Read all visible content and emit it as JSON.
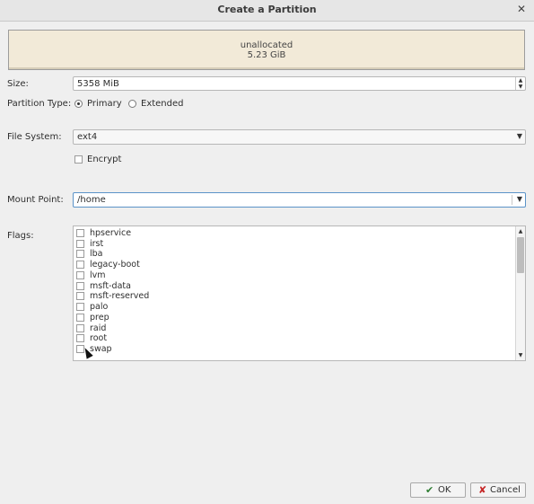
{
  "window": {
    "title": "Create a Partition"
  },
  "partition": {
    "name": "unallocated",
    "size_text": "5.23 GiB"
  },
  "size": {
    "label": "Size:",
    "value": "5358 MiB"
  },
  "partition_type": {
    "label": "Partition Type:",
    "primary": "Primary",
    "extended": "Extended",
    "selected": "Primary"
  },
  "file_system": {
    "label": "File System:",
    "value": "ext4"
  },
  "encrypt": {
    "label": "Encrypt",
    "checked": false
  },
  "mount_point": {
    "label": "Mount Point:",
    "value": "/home"
  },
  "flags": {
    "label": "Flags:",
    "items": [
      "hpservice",
      "irst",
      "lba",
      "legacy-boot",
      "lvm",
      "msft-data",
      "msft-reserved",
      "palo",
      "prep",
      "raid",
      "root",
      "swap"
    ]
  },
  "buttons": {
    "ok": "OK",
    "cancel": "Cancel"
  },
  "colors": {
    "partition_bg": "#f2ead8",
    "focus_border": "#5b93c8"
  }
}
